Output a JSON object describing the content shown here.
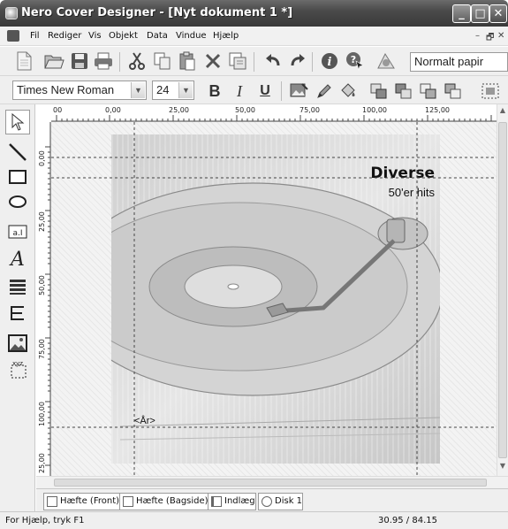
{
  "window": {
    "title": "Nero Cover Designer - [Nyt dokument 1 *]"
  },
  "menubar": {
    "items": [
      "Fil",
      "Rediger",
      "Vis",
      "Objekt",
      "Data",
      "Vindue",
      "Hjælp"
    ]
  },
  "toolbar": {
    "paper_type": "Normalt papir"
  },
  "format_bar": {
    "font_family": "Times New Roman",
    "font_size": "24"
  },
  "rulers": {
    "horizontal_labels": [
      "00",
      "0,00",
      "25,00",
      "50,00",
      "75,00",
      "100,00",
      "125,00"
    ],
    "vertical_labels": [
      "0,00",
      "25,00",
      "50,00",
      "75,00",
      "100,00",
      "25,00"
    ]
  },
  "cover": {
    "title": "Diverse",
    "subtitle": "50'er hits",
    "year_field": "<År>"
  },
  "tabs": [
    {
      "label": "Hæfte (Front)",
      "icon": "page-icon"
    },
    {
      "label": "Hæfte (Bagside)",
      "icon": "page-icon"
    },
    {
      "label": "Indlæg",
      "icon": "inlay-icon"
    },
    {
      "label": "Disk 1",
      "icon": "disc-icon"
    }
  ],
  "status": {
    "help": "For Hjælp, tryk F1",
    "coords": "30.95 / 84.15"
  }
}
